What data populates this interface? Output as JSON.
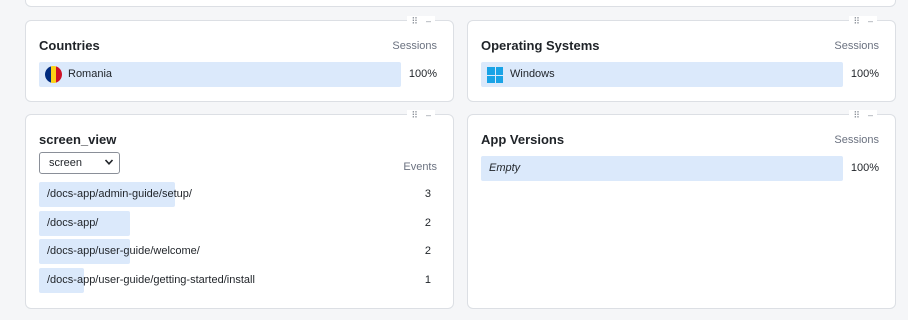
{
  "countries": {
    "title": "Countries",
    "metric": "Sessions",
    "rows": [
      {
        "label": "Romania",
        "value": "100%",
        "share": 1.0,
        "icon": "romania-flag-icon"
      }
    ]
  },
  "os": {
    "title": "Operating Systems",
    "metric": "Sessions",
    "rows": [
      {
        "label": "Windows",
        "value": "100%",
        "share": 1.0,
        "icon": "windows-logo-icon"
      }
    ]
  },
  "screen_view": {
    "title": "screen_view",
    "select_value": "screen",
    "metric": "Events",
    "rows": [
      {
        "label": "/docs-app/admin-guide/setup/",
        "value": "3",
        "share": 1.0
      },
      {
        "label": "/docs-app/",
        "value": "2",
        "share": 0.667
      },
      {
        "label": "/docs-app/user-guide/welcome/",
        "value": "2",
        "share": 0.667
      },
      {
        "label": "/docs-app/user-guide/getting-started/install",
        "value": "1",
        "share": 0.333
      }
    ]
  },
  "app_versions": {
    "title": "App Versions",
    "metric": "Sessions",
    "rows": [
      {
        "label": "Empty",
        "value": "100%",
        "share": 1.0
      }
    ]
  },
  "colors": {
    "bar": "#dbe9fb",
    "border": "#dcdfe4",
    "windows_blue": "#19a3e6"
  }
}
